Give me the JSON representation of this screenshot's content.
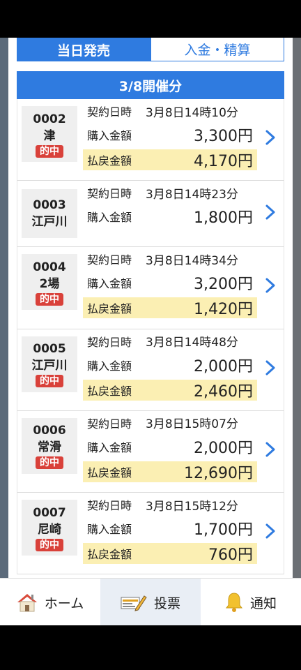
{
  "tabs": {
    "today": "当日発売",
    "deposit": "入金・精算"
  },
  "section_header": "3/8開催分",
  "labels": {
    "date": "契約日時",
    "purchase": "購入金額",
    "payout": "払戻金額",
    "hit": "的中"
  },
  "rows": [
    {
      "no": "0002",
      "venue": "津",
      "hit": true,
      "datetime": "3月8日14時10分",
      "purchase": "3,300円",
      "payout": "4,170円"
    },
    {
      "no": "0003",
      "venue": "江戸川",
      "hit": false,
      "datetime": "3月8日14時23分",
      "purchase": "1,800円",
      "payout": ""
    },
    {
      "no": "0004",
      "venue": "2場",
      "hit": true,
      "datetime": "3月8日14時34分",
      "purchase": "3,200円",
      "payout": "1,420円"
    },
    {
      "no": "0005",
      "venue": "江戸川",
      "hit": true,
      "datetime": "3月8日14時48分",
      "purchase": "2,000円",
      "payout": "2,460円"
    },
    {
      "no": "0006",
      "venue": "常滑",
      "hit": true,
      "datetime": "3月8日15時07分",
      "purchase": "2,000円",
      "payout": "12,690円"
    },
    {
      "no": "0007",
      "venue": "尼崎",
      "hit": true,
      "datetime": "3月8日15時12分",
      "purchase": "1,700円",
      "payout": "760円"
    }
  ],
  "nav": {
    "home": "ホーム",
    "vote": "投票",
    "notify": "通知"
  },
  "colors": {
    "accent": "#2f7be0",
    "hit_badge": "#d9413a",
    "payout_highlight": "#fbefb3"
  }
}
